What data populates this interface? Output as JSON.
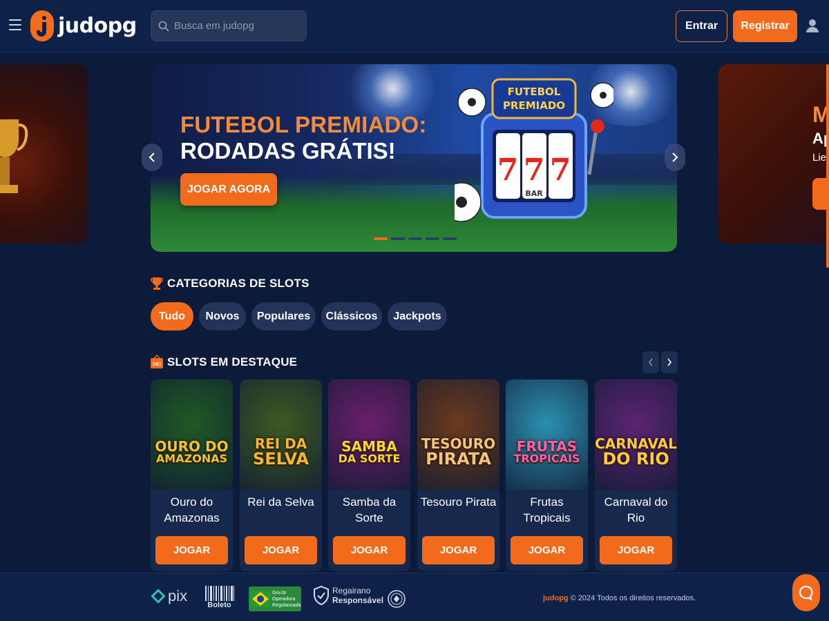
{
  "header": {
    "logo_text": "judopg",
    "search_placeholder": "Busca em judopg",
    "login_label": "Entrar",
    "register_label": "Registrar"
  },
  "banner": {
    "title_line_1": "FUTEBOL PREMIADO:",
    "title_line_2": "RODADAS GRÁTIS!",
    "cta_label": "JOGAR AGORA",
    "machine_sign": [
      "FUTEBOL",
      "PREMIADO"
    ],
    "reel_symbols": [
      "7",
      "7",
      "7"
    ],
    "reel_footer": "BAR",
    "dots_total": 5,
    "dots_active_index": 0
  },
  "side_banner_right": {
    "line_1": "M",
    "line_2": "Ap",
    "line_3": "Lie"
  },
  "categories": {
    "title": "CATEGORIAS DE SLOTS",
    "chips": [
      {
        "label": "Tudo",
        "active": true
      },
      {
        "label": "Novos",
        "active": false
      },
      {
        "label": "Populares",
        "active": false
      },
      {
        "label": "Clássicos",
        "active": false
      },
      {
        "label": "Jackpots",
        "active": false
      }
    ]
  },
  "featured": {
    "title": "SLOTS EM DESTAQUE",
    "badge_text": "DE!",
    "games": [
      {
        "art_line_1": "OURO DO",
        "art_line_2": "AMAZONAS",
        "name": "Ouro do Amazonas",
        "play_label": "JOGAR",
        "bg": "#1f5a25",
        "fg": "#f6c12f"
      },
      {
        "art_line_1": "REI DA",
        "art_line_2": "SELVA",
        "name": "Rei da Selva",
        "play_label": "JOGAR",
        "bg": "#3d5a22",
        "fg": "#f7b52c"
      },
      {
        "art_line_1": "SAMBA",
        "art_line_2": "DA SORTE",
        "name": "Samba da Sorte",
        "play_label": "JOGAR",
        "bg": "#6a1f6b",
        "fg": "#ffd531"
      },
      {
        "art_line_1": "TESOURO",
        "art_line_2": "PIRATA",
        "name": "Tesouro Pirata",
        "play_label": "JOGAR",
        "bg": "#6b3a1e",
        "fg": "#f3c47b"
      },
      {
        "art_line_1": "FRUTAS",
        "art_line_2": "TROPICAIS",
        "name": "Frutas Tropicais",
        "play_label": "JOGAR",
        "bg": "#2c8fb0",
        "fg": "#ff5fa8"
      },
      {
        "art_line_1": "CARNAVAL",
        "art_line_2": "DO RIO",
        "name": "Carnaval do Rio",
        "play_label": "JOGAR",
        "bg": "#5b2472",
        "fg": "#ffcb3a"
      }
    ]
  },
  "footer": {
    "pix_label": "pix",
    "boleto_label": "Boleto",
    "gov_lines": [
      "Gov.br",
      "Operadora",
      "Regularizada"
    ],
    "responsible_line_1": "Regairano",
    "responsible_line_2": "Responsável",
    "brand": "judopg",
    "copyright": "© 2024 Todos os direitos reservados."
  },
  "colors": {
    "accent": "#f26b1d",
    "background": "#0c1b3a",
    "header": "#0e2148",
    "chip": "#223459"
  }
}
